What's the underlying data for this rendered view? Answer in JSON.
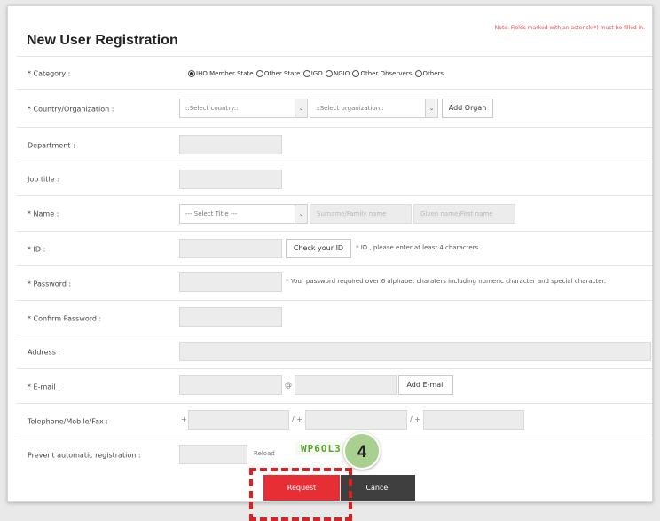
{
  "note": "Note: Fields marked with an asterisk(*) must be filled in.",
  "title": "New User Registration",
  "labels": {
    "category": "* Category :",
    "country": "* Country/Organization :",
    "department": "Department :",
    "job_title": "Job title :",
    "name": "* Name :",
    "id": "* ID :",
    "password": "* Password :",
    "confirm_password": "* Confirm Password :",
    "address": "Address :",
    "email": "* E-mail :",
    "phone": "Telephone/Mobile/Fax :",
    "prevent": "Prevent automatic registration :"
  },
  "category_options": [
    {
      "label": "IHO Member State",
      "selected": true
    },
    {
      "label": "Other State",
      "selected": false
    },
    {
      "label": "IGO",
      "selected": false
    },
    {
      "label": "NGIO",
      "selected": false
    },
    {
      "label": "Other Observers",
      "selected": false
    },
    {
      "label": "Others",
      "selected": false
    }
  ],
  "country_select": "::Select country::",
  "organization_select": "::Select organization::",
  "add_organ": "Add Organ",
  "title_select": "--- Select Title ---",
  "surname_placeholder": "Surname/Family name",
  "given_placeholder": "Given name/First name",
  "check_id": "Check your ID",
  "id_hint": "* ID , please enter at least 4 characters",
  "password_hint": "* Your password required over 6 alphabet charaters including numeric character and special character.",
  "at_symbol": "@",
  "add_email": "Add E-mail",
  "phone_prefix1": "+",
  "phone_prefix2": "/ +",
  "phone_prefix3": "/ +",
  "reload": "Reload",
  "captcha": "WP6OL3",
  "request": "Request",
  "cancel": "Cancel",
  "step": "4",
  "colors": {
    "accent": "#e62e35",
    "cancel": "#3f3f3f",
    "highlight": "#e0201f",
    "step_badge": "#a9d08e",
    "captcha": "#5aa02c"
  }
}
